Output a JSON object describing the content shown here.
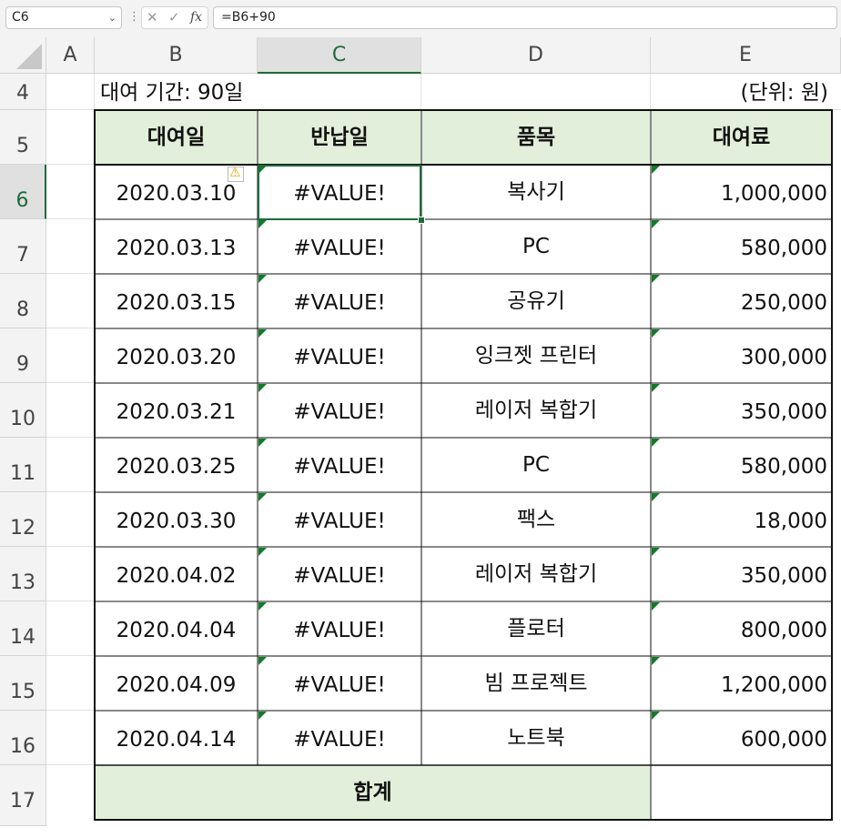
{
  "formula_bar": {
    "name_box": "C6",
    "name_dropdown": "⌄",
    "separator": "⋮",
    "cancel": "✕",
    "enter": "✓",
    "fx": "fx",
    "formula": "=B6+90"
  },
  "columns": [
    "A",
    "B",
    "C",
    "D",
    "E"
  ],
  "rows": [
    "4",
    "5",
    "6",
    "7",
    "8",
    "9",
    "10",
    "11",
    "12",
    "13",
    "14",
    "15",
    "16",
    "17"
  ],
  "selected_cell": "C6",
  "sheet": {
    "title": "대여 기간: 90일",
    "unit": "(단위: 원)",
    "headers": {
      "rent_date": "대여일",
      "return_date": "반납일",
      "item": "품목",
      "fee": "대여료"
    },
    "records": [
      {
        "rent_date": "2020.03.10",
        "return_date": "#VALUE!",
        "item": "복사기",
        "fee": "1,000,000"
      },
      {
        "rent_date": "2020.03.13",
        "return_date": "#VALUE!",
        "item": "PC",
        "fee": "580,000"
      },
      {
        "rent_date": "2020.03.15",
        "return_date": "#VALUE!",
        "item": "공유기",
        "fee": "250,000"
      },
      {
        "rent_date": "2020.03.20",
        "return_date": "#VALUE!",
        "item": "잉크젯 프린터",
        "fee": "300,000"
      },
      {
        "rent_date": "2020.03.21",
        "return_date": "#VALUE!",
        "item": "레이저 복합기",
        "fee": "350,000"
      },
      {
        "rent_date": "2020.03.25",
        "return_date": "#VALUE!",
        "item": "PC",
        "fee": "580,000"
      },
      {
        "rent_date": "2020.03.30",
        "return_date": "#VALUE!",
        "item": "팩스",
        "fee": "18,000"
      },
      {
        "rent_date": "2020.04.02",
        "return_date": "#VALUE!",
        "item": "레이저 복합기",
        "fee": "350,000"
      },
      {
        "rent_date": "2020.04.04",
        "return_date": "#VALUE!",
        "item": "플로터",
        "fee": "800,000"
      },
      {
        "rent_date": "2020.04.09",
        "return_date": "#VALUE!",
        "item": "빔 프로젝트",
        "fee": "1,200,000"
      },
      {
        "rent_date": "2020.04.14",
        "return_date": "#VALUE!",
        "item": "노트북",
        "fee": "600,000"
      }
    ],
    "total_label": "합계",
    "total_value": ""
  },
  "colors": {
    "header_fill": "#e2efda",
    "selection": "#1e6b3b",
    "error_triangle": "#137a2a",
    "warning_icon": "#e0a400"
  }
}
